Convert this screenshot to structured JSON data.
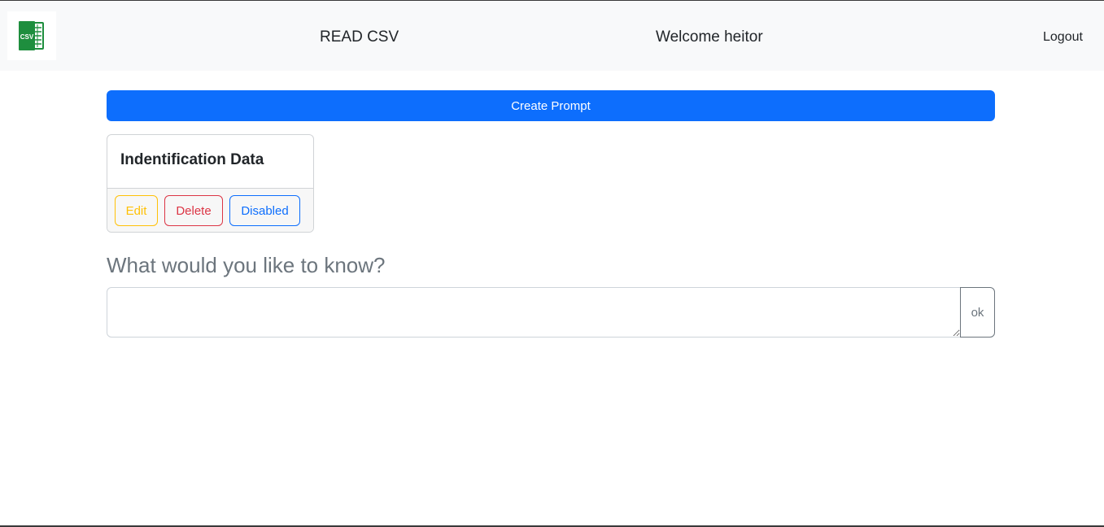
{
  "header": {
    "logo_icon": "csv-file-icon",
    "logo_text": "CSV",
    "app_title": "READ CSV",
    "welcome_text": "Welcome heitor",
    "logout_label": "Logout"
  },
  "actions": {
    "create_prompt_label": "Create Prompt"
  },
  "prompts": [
    {
      "title": "Indentification Data",
      "edit_label": "Edit",
      "delete_label": "Delete",
      "status_label": "Disabled"
    }
  ],
  "question": {
    "label": "What would you like to know?",
    "value": "",
    "placeholder": "",
    "submit_label": "ok"
  },
  "colors": {
    "primary": "#0d6efd",
    "warning": "#ffc107",
    "danger": "#dc3545",
    "secondary": "#6c757d",
    "navbar_bg": "#f8f9fa",
    "logo_green": "#1e8e3e"
  }
}
